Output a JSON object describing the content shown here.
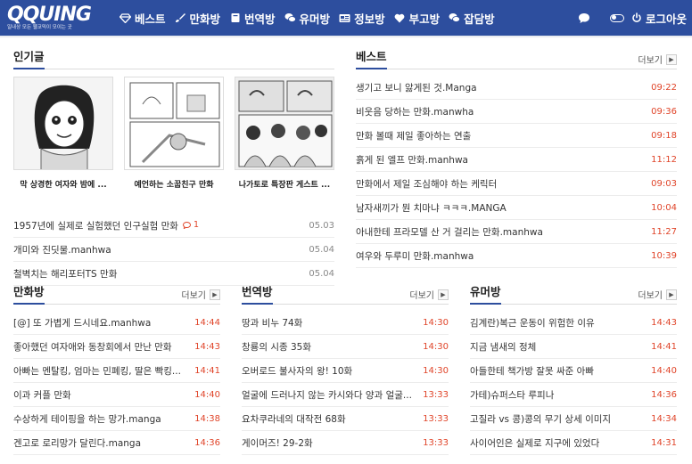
{
  "logo": {
    "main": "QQUING",
    "sub": "일내상 모든 웹코믹이 모이는 곳"
  },
  "nav": [
    {
      "label": "베스트",
      "icon": "diamond-icon"
    },
    {
      "label": "만화방",
      "icon": "brush-icon"
    },
    {
      "label": "번역방",
      "icon": "book-icon"
    },
    {
      "label": "유머방",
      "icon": "comments-icon"
    },
    {
      "label": "정보방",
      "icon": "newspaper-icon"
    },
    {
      "label": "부고방",
      "icon": "heart-icon"
    },
    {
      "label": "잡담방",
      "icon": "chat-bubbles-icon"
    }
  ],
  "header_right": {
    "logout": "로그아웃"
  },
  "colors": {
    "header": "#2d4e9e",
    "time": "#e0452a"
  },
  "more_label": "더보기",
  "popular": {
    "title": "인기글",
    "thumbs": [
      {
        "caption": "막 상경한 여자와 밤에 ..."
      },
      {
        "caption": "예언하는 소꿉친구 만화"
      },
      {
        "caption": "나가토로 특장판 게스트 ..."
      }
    ],
    "rows": [
      {
        "title": "1957년에 실제로 실험했던 인구실험 만화",
        "comments": "1",
        "date": "05.03"
      },
      {
        "title": "개미와 진딧물.manhwa",
        "comments": "",
        "date": "05.04"
      },
      {
        "title": "철벽치는 해리포터TS 만화",
        "comments": "",
        "date": "05.04"
      }
    ]
  },
  "best": {
    "title": "베스트",
    "rows": [
      {
        "title": "생기고 보니 앓게된 것.Manga",
        "time": "09:22"
      },
      {
        "title": "비웃음 당하는 만화.manwha",
        "time": "09:36"
      },
      {
        "title": "만화 볼때 제일 좋아하는 연출",
        "time": "09:18"
      },
      {
        "title": "흙게 된 엘프 만화.manhwa",
        "time": "11:12"
      },
      {
        "title": "만화에서 제일 조심해야 하는 케릭터",
        "time": "09:03"
      },
      {
        "title": "남자새끼가 뭔 치마냐 ㅋㅋㅋ.MANGA",
        "time": "10:04"
      },
      {
        "title": "아내한테 프라모델 산 거 걸리는 만화.manhwa",
        "time": "11:27"
      },
      {
        "title": "여우와 두루미 만화.manhwa",
        "time": "10:39"
      }
    ]
  },
  "manhwa": {
    "title": "만화방",
    "rows": [
      {
        "title": "[@] 또 가볍게 드시네요.manhwa",
        "time": "14:44"
      },
      {
        "title": "좋아했던 여자애와 동창회에서 만난 만화",
        "time": "14:43"
      },
      {
        "title": "아빠는 멘탈킹, 엄마는 민폐킹, 딸은 빡킹...",
        "time": "14:41"
      },
      {
        "title": "이과 커플 만화",
        "time": "14:40"
      },
      {
        "title": "수상하게 테이핑을 하는 망가.manga",
        "time": "14:38"
      },
      {
        "title": "겐고로 로리망가 달린다.manga",
        "time": "14:36"
      }
    ]
  },
  "translate": {
    "title": "번역방",
    "rows": [
      {
        "title": "땅과 비누 74화",
        "time": "14:30"
      },
      {
        "title": "창룡의 시종 35화",
        "time": "14:30"
      },
      {
        "title": "오버로드 불사자의 왕! 10화",
        "time": "14:30"
      },
      {
        "title": "얼굴에 드러나지 않는 카시와다 양과 얼굴...",
        "time": "13:33"
      },
      {
        "title": "요차쿠라네의 대작전 68화",
        "time": "13:33"
      },
      {
        "title": "게이머즈! 29-2화",
        "time": "13:33"
      }
    ]
  },
  "humor": {
    "title": "유머방",
    "rows": [
      {
        "title": "김계란)복근 운동이 위험한 이유",
        "time": "14:43"
      },
      {
        "title": "지금 냄새의 정체",
        "time": "14:41"
      },
      {
        "title": "아들한테 책가방 잘못 싸준 아빠",
        "time": "14:40"
      },
      {
        "title": "가테)슈퍼스타 루피나",
        "time": "14:36"
      },
      {
        "title": "고질라 vs 콩)콩의 무기 상세 이미지",
        "time": "14:34"
      },
      {
        "title": "사이어인은 실제로 지구에 있었다",
        "time": "14:31"
      }
    ]
  }
}
